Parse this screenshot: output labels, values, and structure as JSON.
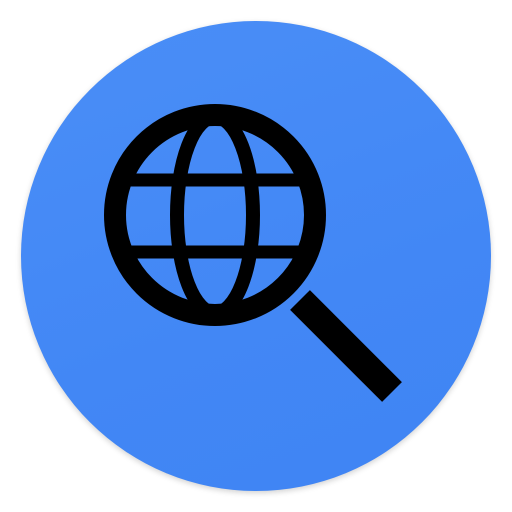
{
  "app_icon": {
    "name": "globe-search-icon",
    "background_color": "#4287f5",
    "glyph_color": "#000000",
    "glyph": "magnifying-glass-over-globe"
  }
}
